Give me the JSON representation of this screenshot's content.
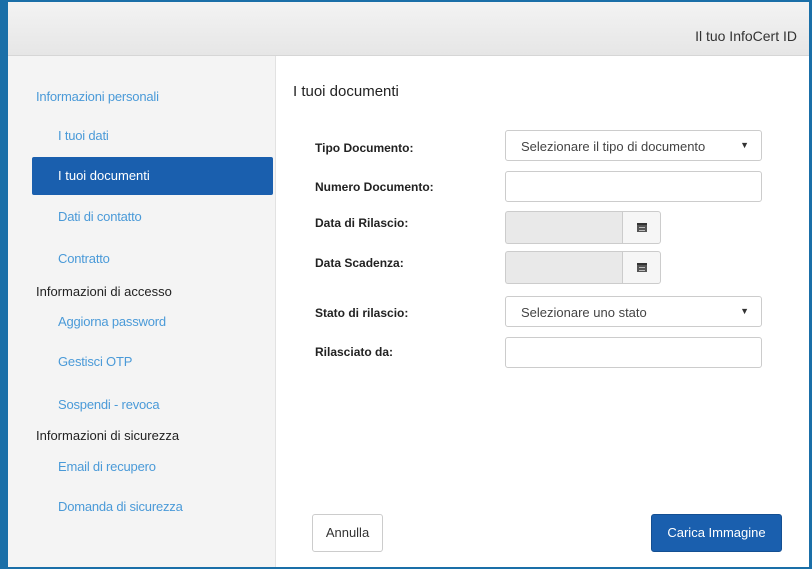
{
  "header": {
    "app_title": "Il tuo InfoCert ID"
  },
  "sidebar": {
    "personal_info": "Informazioni personali",
    "items_personal": [
      {
        "label": "I tuoi dati"
      },
      {
        "label": "I tuoi documenti"
      },
      {
        "label": "Dati di contatto"
      },
      {
        "label": "Contratto"
      }
    ],
    "access_group": "Informazioni di accesso",
    "items_access": [
      {
        "label": "Aggiorna password"
      },
      {
        "label": "Gestisci OTP"
      },
      {
        "label": "Sospendi - revoca"
      }
    ],
    "security_group": "Informazioni di sicurezza",
    "items_security": [
      {
        "label": "Email di recupero"
      },
      {
        "label": "Domanda di sicurezza"
      }
    ],
    "active_item": "I tuoi documenti"
  },
  "main": {
    "title": "I tuoi documenti",
    "fields": {
      "tipo_documento": {
        "label": "Tipo Documento:",
        "value": "Selezionare il tipo di documento"
      },
      "numero_documento": {
        "label": "Numero Documento:",
        "value": ""
      },
      "data_rilascio": {
        "label": "Data di Rilascio:",
        "value": ""
      },
      "data_scadenza": {
        "label": "Data Scadenza:",
        "value": ""
      },
      "stato_rilascio": {
        "label": "Stato di rilascio:",
        "value": "Selezionare uno stato"
      },
      "rilasciato_da": {
        "label": "Rilasciato da:",
        "value": ""
      }
    },
    "buttons": {
      "cancel": "Annulla",
      "upload": "Carica Immagine"
    }
  },
  "colors": {
    "accent": "#1a5fae",
    "link": "#4a9ad8",
    "frame": "#1a6fa8"
  }
}
